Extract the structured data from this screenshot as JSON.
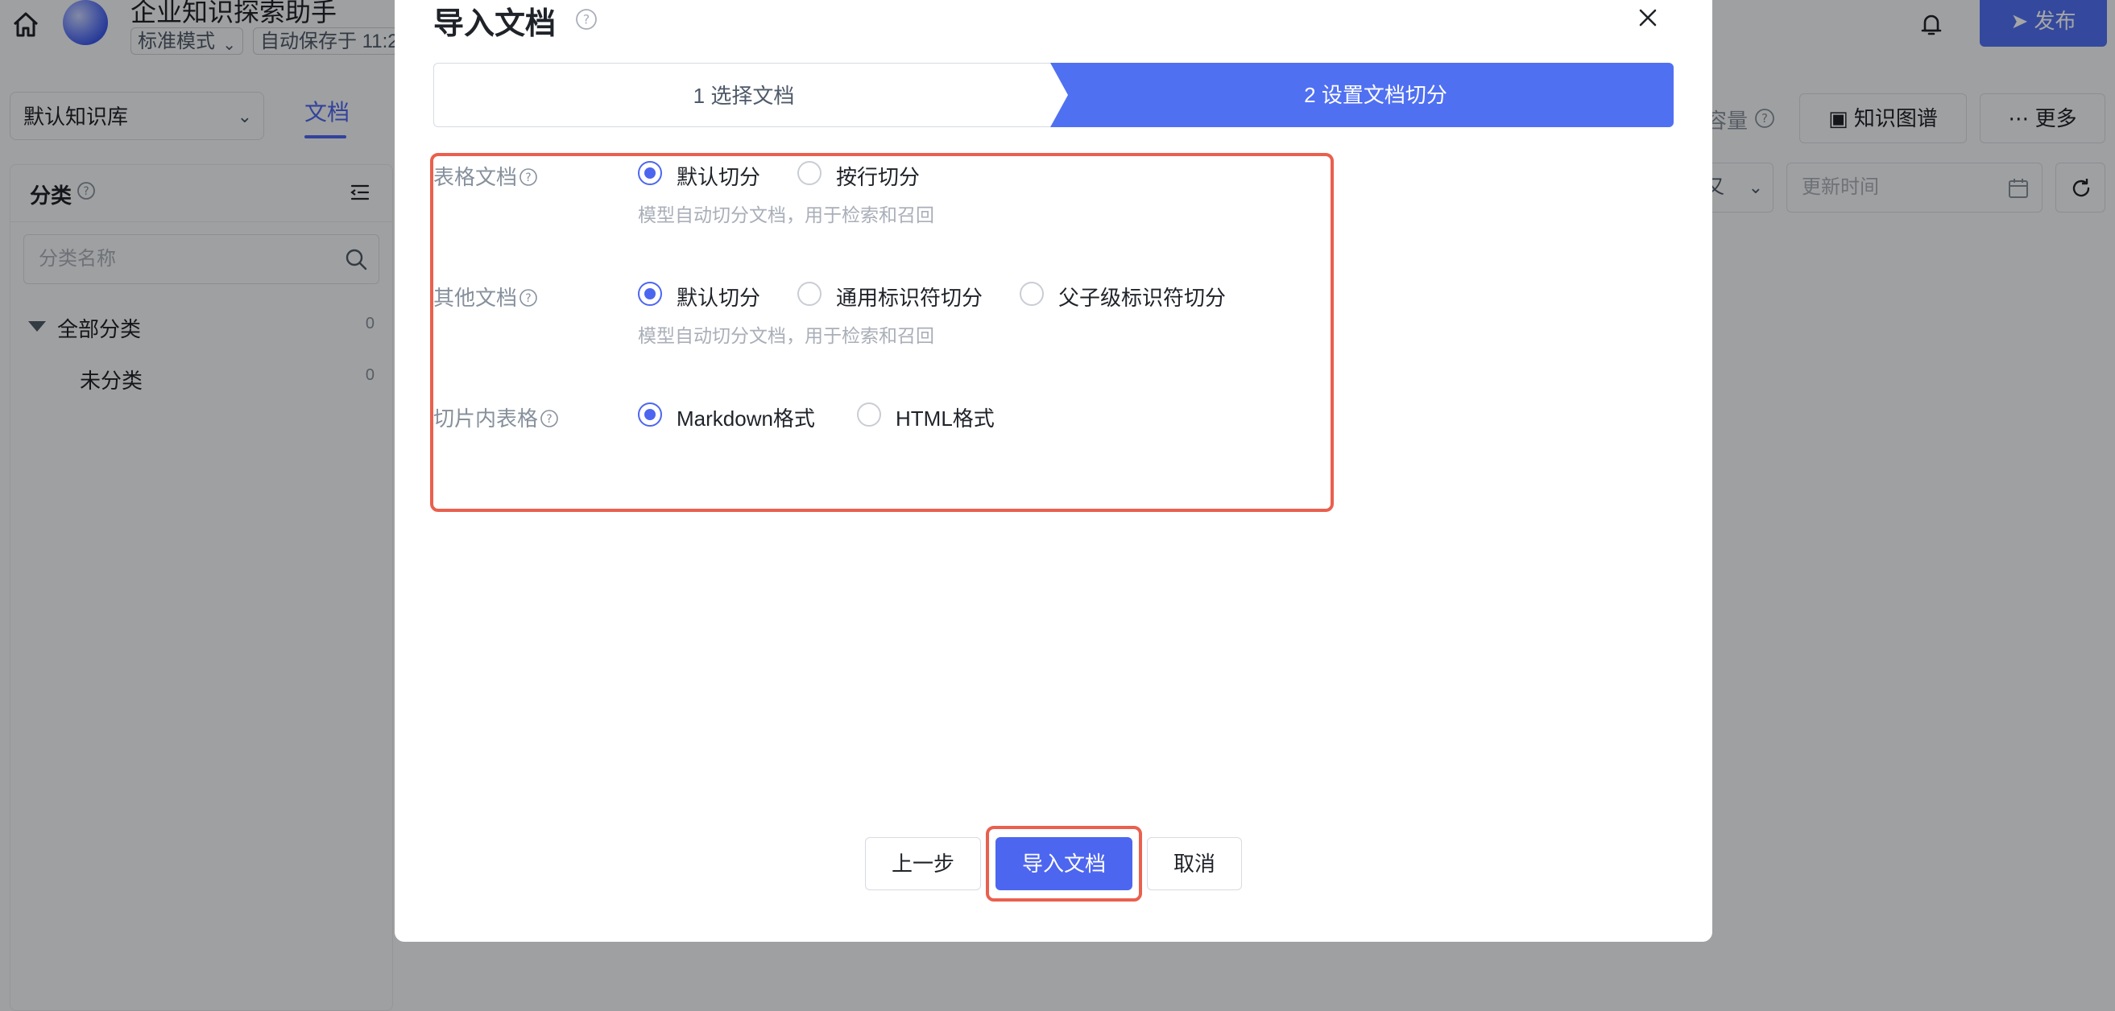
{
  "app": {
    "title": "企业知识探索助手",
    "mode": "标准模式",
    "autosave": "自动保存于 11:2",
    "publish_label": "发布"
  },
  "knowledge_base": {
    "selected": "默认知识库",
    "tab_docs": "文档"
  },
  "sidebar": {
    "title": "分类",
    "search_placeholder": "分类名称",
    "tree": [
      {
        "label": "全部分类",
        "count": "0"
      },
      {
        "label": "未分类",
        "count": "0"
      }
    ]
  },
  "toolbar": {
    "capacity_label": "容量",
    "graph_label": "知识图谱",
    "more_label": "更多",
    "filter_fragment": "又",
    "date_placeholder": "更新时间"
  },
  "modal": {
    "title": "导入文档",
    "steps": [
      {
        "label": "1 选择文档",
        "active": false
      },
      {
        "label": "2 设置文档切分",
        "active": true
      }
    ],
    "rows": [
      {
        "label": "表格文档",
        "options": [
          {
            "label": "默认切分",
            "selected": true
          },
          {
            "label": "按行切分",
            "selected": false
          }
        ],
        "hint": "模型自动切分文档，用于检索和召回"
      },
      {
        "label": "其他文档",
        "options": [
          {
            "label": "默认切分",
            "selected": true
          },
          {
            "label": "通用标识符切分",
            "selected": false
          },
          {
            "label": "父子级标识符切分",
            "selected": false
          }
        ],
        "hint": "模型自动切分文档，用于检索和召回"
      },
      {
        "label": "切片内表格",
        "options": [
          {
            "label": "Markdown格式",
            "selected": true
          },
          {
            "label": "HTML格式",
            "selected": false
          }
        ]
      }
    ],
    "buttons": {
      "prev": "上一步",
      "import": "导入文档",
      "cancel": "取消"
    }
  },
  "colors": {
    "accent": "#4d66f0",
    "highlight": "#e9604e"
  }
}
